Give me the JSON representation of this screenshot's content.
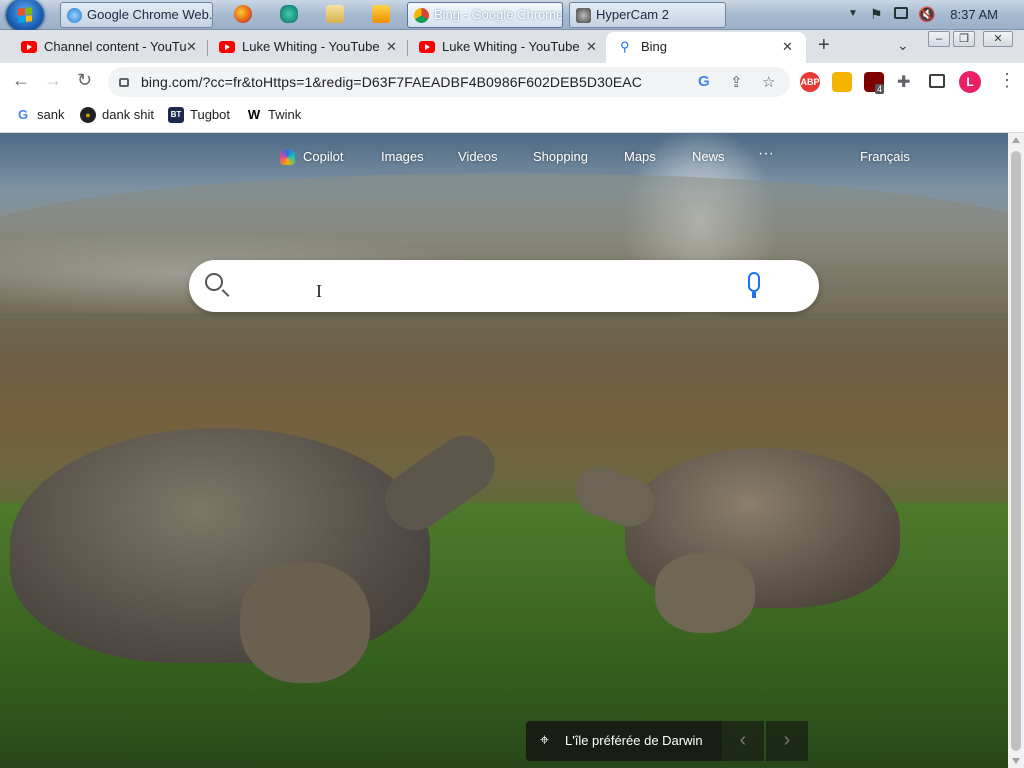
{
  "taskbar": {
    "tasks": [
      {
        "label": "Google Chrome Web..."
      },
      {
        "label": "Bing - Google Chrome"
      },
      {
        "label": "HyperCam 2"
      }
    ],
    "clock": "8:37 AM"
  },
  "tabs": [
    {
      "label": "Channel content - YouTu"
    },
    {
      "label": "Luke Whiting - YouTube"
    },
    {
      "label": "Luke Whiting - YouTube"
    },
    {
      "label": "Bing"
    }
  ],
  "tab_close": "✕",
  "new_tab": "+",
  "address_bar": {
    "url": "bing.com/?cc=fr&toHttps=1&redig=D63F7FAEADBF4B0986F602DEB5D30EAC"
  },
  "extensions": {
    "abp": "ABP",
    "ublock_count": "4",
    "profile": "L"
  },
  "bookmarks": [
    {
      "label": "sank",
      "icon": "G"
    },
    {
      "label": "dank shit",
      "icon": "●"
    },
    {
      "label": "Tugbot",
      "icon": "BT"
    },
    {
      "label": "Twink",
      "icon": "W"
    }
  ],
  "bing": {
    "nav": [
      "Copilot",
      "Images",
      "Videos",
      "Shopping",
      "Maps",
      "News"
    ],
    "more": "···",
    "language": "Français",
    "caption": "L'île préférée de Darwin",
    "prev": "‹",
    "next": "›"
  }
}
